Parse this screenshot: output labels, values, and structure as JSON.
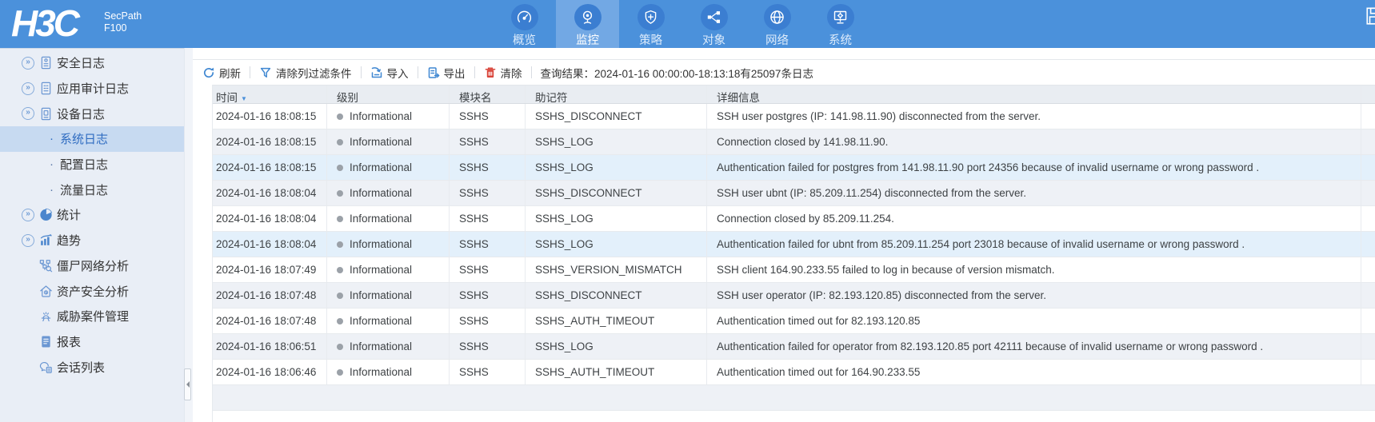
{
  "header": {
    "logo": "H3C",
    "product_line1": "SecPath",
    "product_line2": "F100",
    "nav": [
      {
        "label": "概览",
        "icon": "gauge-icon",
        "active": false
      },
      {
        "label": "监控",
        "icon": "monitor-cam-icon",
        "active": true
      },
      {
        "label": "策略",
        "icon": "shield-plus-icon",
        "active": false
      },
      {
        "label": "对象",
        "icon": "share-nodes-icon",
        "active": false
      },
      {
        "label": "网络",
        "icon": "globe-icon",
        "active": false
      },
      {
        "label": "系统",
        "icon": "system-gear-icon",
        "active": false
      }
    ]
  },
  "sidebar": {
    "items": [
      {
        "label": "安全日志",
        "icon": "log-doc-icon",
        "expandable": true
      },
      {
        "label": "应用审计日志",
        "icon": "log-audit-icon",
        "expandable": true
      },
      {
        "label": "设备日志",
        "icon": "log-device-icon",
        "expandable": true,
        "children": [
          {
            "label": "系统日志",
            "selected": true
          },
          {
            "label": "配置日志",
            "selected": false
          },
          {
            "label": "流量日志",
            "selected": false
          }
        ]
      },
      {
        "label": "统计",
        "icon": "stats-pie-icon",
        "expandable": true
      },
      {
        "label": "趋势",
        "icon": "trend-chart-icon",
        "expandable": true
      },
      {
        "label": "僵尸网络分析",
        "icon": "botnet-analysis-icon",
        "expandable": false
      },
      {
        "label": "资产安全分析",
        "icon": "asset-security-icon",
        "expandable": false
      },
      {
        "label": "威胁案件管理",
        "icon": "threat-case-icon",
        "expandable": false
      },
      {
        "label": "报表",
        "icon": "report-icon",
        "expandable": false
      },
      {
        "label": "会话列表",
        "icon": "session-list-icon",
        "expandable": false
      }
    ]
  },
  "toolbar": {
    "buttons": [
      {
        "label": "刷新",
        "icon": "refresh-icon",
        "color": "#3f87d2"
      },
      {
        "label": "清除列过滤条件",
        "icon": "filter-icon",
        "color": "#3f87d2"
      },
      {
        "label": "导入",
        "icon": "import-icon",
        "color": "#3f87d2"
      },
      {
        "label": "导出",
        "icon": "export-icon",
        "color": "#3f87d2"
      },
      {
        "label": "清除",
        "icon": "trash-icon",
        "color": "#d9453a"
      }
    ],
    "query_result": "查询结果：2024-01-16 00:00:00-18:13:18有25097条日志"
  },
  "table": {
    "columns": [
      {
        "label": "时间",
        "sorted": true
      },
      {
        "label": "级别",
        "sorted": false
      },
      {
        "label": "模块名",
        "sorted": false
      },
      {
        "label": "助记符",
        "sorted": false
      },
      {
        "label": "详细信息",
        "sorted": false
      }
    ],
    "rows": [
      {
        "time": "2024-01-16 18:08:15",
        "level": "Informational",
        "module": "SSHS",
        "mnemonic": "SSHS_DISCONNECT",
        "detail": "SSH user postgres (IP: 141.98.11.90) disconnected from the server.",
        "highlighted": false
      },
      {
        "time": "2024-01-16 18:08:15",
        "level": "Informational",
        "module": "SSHS",
        "mnemonic": "SSHS_LOG",
        "detail": "Connection closed by 141.98.11.90.",
        "highlighted": false
      },
      {
        "time": "2024-01-16 18:08:15",
        "level": "Informational",
        "module": "SSHS",
        "mnemonic": "SSHS_LOG",
        "detail": "Authentication failed for postgres from 141.98.11.90 port 24356 because of invalid username or wrong password .",
        "highlighted": true
      },
      {
        "time": "2024-01-16 18:08:04",
        "level": "Informational",
        "module": "SSHS",
        "mnemonic": "SSHS_DISCONNECT",
        "detail": "SSH user ubnt (IP: 85.209.11.254) disconnected from the server.",
        "highlighted": false
      },
      {
        "time": "2024-01-16 18:08:04",
        "level": "Informational",
        "module": "SSHS",
        "mnemonic": "SSHS_LOG",
        "detail": "Connection closed by 85.209.11.254.",
        "highlighted": false
      },
      {
        "time": "2024-01-16 18:08:04",
        "level": "Informational",
        "module": "SSHS",
        "mnemonic": "SSHS_LOG",
        "detail": "Authentication failed for ubnt from 85.209.11.254 port 23018 because of invalid username or wrong password .",
        "highlighted": true
      },
      {
        "time": "2024-01-16 18:07:49",
        "level": "Informational",
        "module": "SSHS",
        "mnemonic": "SSHS_VERSION_MISMATCH",
        "detail": "SSH client 164.90.233.55 failed to log in because of version mismatch.",
        "highlighted": false
      },
      {
        "time": "2024-01-16 18:07:48",
        "level": "Informational",
        "module": "SSHS",
        "mnemonic": "SSHS_DISCONNECT",
        "detail": "SSH user operator (IP: 82.193.120.85) disconnected from the server.",
        "highlighted": false
      },
      {
        "time": "2024-01-16 18:07:48",
        "level": "Informational",
        "module": "SSHS",
        "mnemonic": "SSHS_AUTH_TIMEOUT",
        "detail": "Authentication timed out for 82.193.120.85",
        "highlighted": false
      },
      {
        "time": "2024-01-16 18:06:51",
        "level": "Informational",
        "module": "SSHS",
        "mnemonic": "SSHS_LOG",
        "detail": "Authentication failed for operator from 82.193.120.85 port 42111 because of invalid username or wrong password .",
        "highlighted": false
      },
      {
        "time": "2024-01-16 18:06:46",
        "level": "Informational",
        "module": "SSHS",
        "mnemonic": "SSHS_AUTH_TIMEOUT",
        "detail": "Authentication timed out for 164.90.233.55",
        "highlighted": false
      }
    ]
  },
  "colors": {
    "header_bg": "#4b91db",
    "active_tab_bg": "#72a8e4",
    "nav_circle_bg": "#3b7ed1",
    "sidebar_bg": "#e9eef6",
    "sidebar_selected_bg": "#c7daf1",
    "selected_text": "#2f6cc1",
    "table_header_bg": "#e9edf2",
    "row_stripe_bg": "#eef1f6",
    "row_highlight_bg": "#e3f0fb",
    "toolbar_icon_blue": "#3f87d2",
    "toolbar_icon_red": "#d9453a",
    "level_dot": "#9ba1a8"
  }
}
